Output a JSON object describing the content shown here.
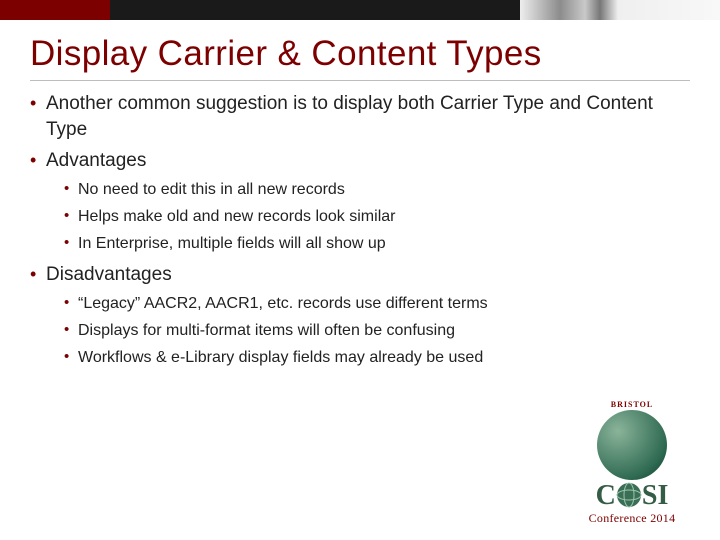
{
  "title": "Display Carrier & Content Types",
  "bullets": {
    "b0": "Another common suggestion is to display both Carrier Type and Content Type",
    "b1": "Advantages",
    "b1_0": "No need to edit this in all new records",
    "b1_1": "Helps make old and new records look similar",
    "b1_2": "In Enterprise, multiple fields will all show up",
    "b2": "Disadvantages",
    "b2_0": "“Legacy” AACR2, AACR1, etc. records use different terms",
    "b2_1": "Displays for multi-format items will often be confusing",
    "b2_2": "Workflows & e-Library display fields may already be used"
  },
  "logo": {
    "ribbon": "BRISTOL",
    "c": "C",
    "s": "S",
    "i": "I",
    "conf": "Conference 2014"
  }
}
